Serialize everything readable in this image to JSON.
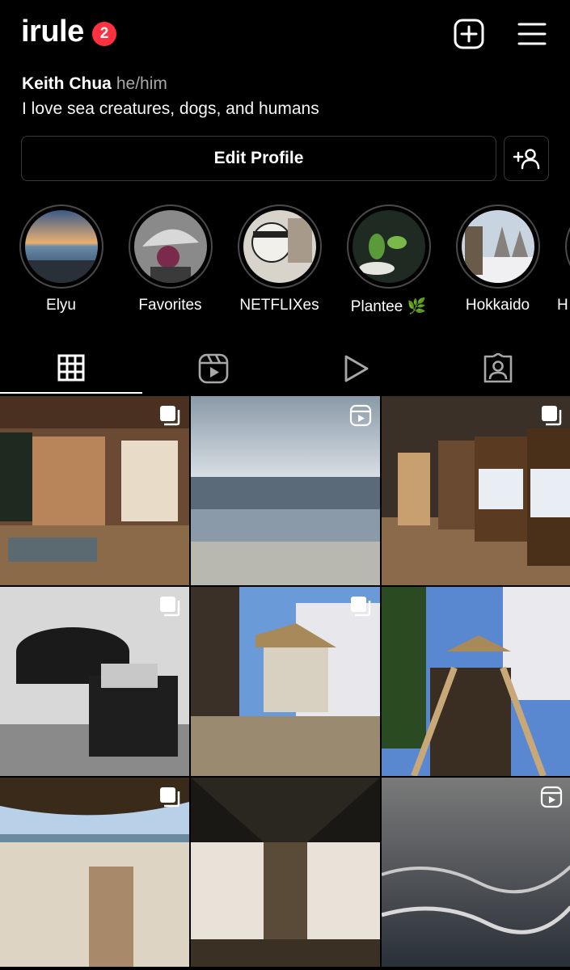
{
  "header": {
    "username": "irule",
    "notification_count": "2",
    "add_icon": "plus-square-icon",
    "menu_icon": "hamburger-menu-icon"
  },
  "profile": {
    "name": "Keith Chua",
    "pronouns": "he/him",
    "bio": "I love sea creatures, dogs, and humans"
  },
  "actions": {
    "edit_profile_label": "Edit Profile",
    "add_person_icon": "add-person-icon"
  },
  "highlights": [
    {
      "label": "Elyu"
    },
    {
      "label": "Favorites"
    },
    {
      "label": "NETFLIXes"
    },
    {
      "label": "Plantee 🌿"
    },
    {
      "label": "Hokkaido"
    },
    {
      "label": "H"
    }
  ],
  "tabs": [
    {
      "name": "grid",
      "icon": "grid-icon",
      "active": true
    },
    {
      "name": "reels",
      "icon": "reels-icon",
      "active": false
    },
    {
      "name": "video",
      "icon": "play-icon",
      "active": false
    },
    {
      "name": "tagged",
      "icon": "tagged-person-icon",
      "active": false
    }
  ],
  "posts": [
    {
      "kind": "carousel",
      "scene": "cafe-interior"
    },
    {
      "kind": "reel",
      "scene": "beach-surf"
    },
    {
      "kind": "carousel",
      "scene": "coffee-jars"
    },
    {
      "kind": "carousel",
      "scene": "grill-bw"
    },
    {
      "kind": "carousel",
      "scene": "cafe-exterior"
    },
    {
      "kind": "none",
      "scene": "wooden-stairs"
    },
    {
      "kind": "carousel",
      "scene": "beach-walkway"
    },
    {
      "kind": "none",
      "scene": "hallway"
    },
    {
      "kind": "reel",
      "scene": "ocean-waves"
    }
  ],
  "colors": {
    "background": "#000000",
    "badge": "#ff3040",
    "border": "#3a3a3a",
    "muted_text": "#a8a8a8"
  }
}
